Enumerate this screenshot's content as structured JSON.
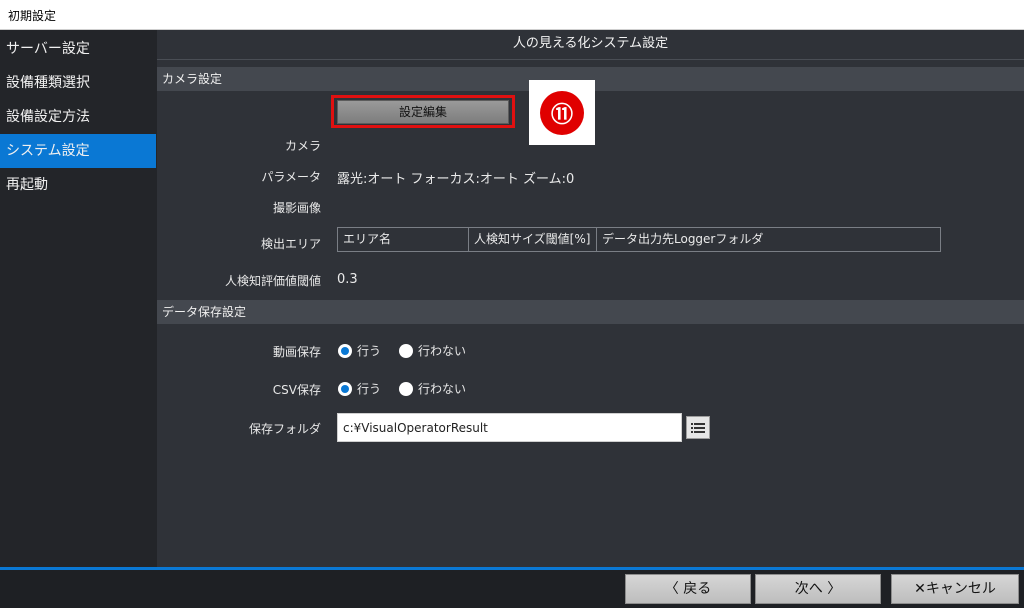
{
  "window": {
    "title": "初期設定"
  },
  "sidebar": {
    "items": [
      {
        "label": "サーバー設定"
      },
      {
        "label": "設備種類選択"
      },
      {
        "label": "設備設定方法"
      },
      {
        "label": "システム設定",
        "active": true
      },
      {
        "label": "再起動"
      }
    ]
  },
  "header": {
    "title": "人の見える化システム設定"
  },
  "camera_section": {
    "title": "カメラ設定",
    "edit_button": "設定編集",
    "callout": "⑪",
    "camera_label": "カメラ",
    "param_label": "パラメータ",
    "param_value": "露光:オート フォーカス:オート ズーム:0",
    "image_label": "撮影画像",
    "area_label": "検出エリア",
    "area_columns": [
      "エリア名",
      "人検知サイズ閾値[%]",
      "データ出力先Loggerフォルダ"
    ],
    "threshold_label": "人検知評価値閾値",
    "threshold_value": "0.3"
  },
  "data_section": {
    "title": "データ保存設定",
    "video_label": "動画保存",
    "video_option_yes": "行う",
    "video_option_no": "行わない",
    "video_selected": "行う",
    "csv_label": "CSV保存",
    "csv_option_yes": "行う",
    "csv_option_no": "行わない",
    "csv_selected": "行う",
    "folder_label": "保存フォルダ",
    "folder_value": "c:¥VisualOperatorResult"
  },
  "footer": {
    "back": "〈 戻る",
    "next": "次へ 〉",
    "cancel": "✕キャンセル"
  },
  "colors": {
    "accent": "#0a78d4",
    "highlight": "#e01010"
  }
}
